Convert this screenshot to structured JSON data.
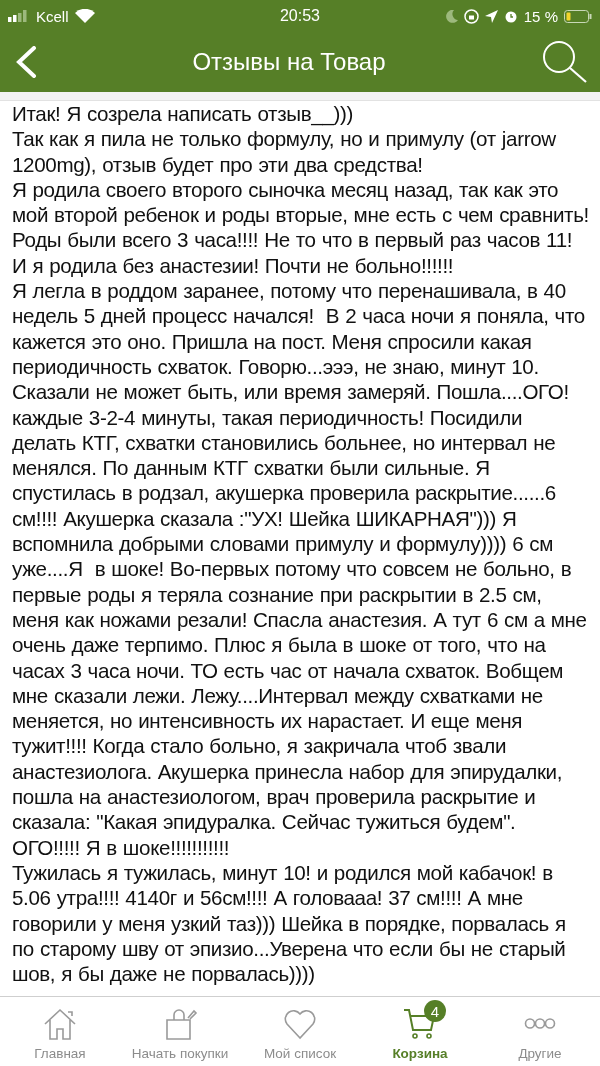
{
  "status_bar": {
    "carrier": "Kcell",
    "time": "20:53",
    "battery": "15 %"
  },
  "nav_bar": {
    "title": "Отзывы на Товар"
  },
  "review": {
    "paragraphs": [
      "Итак! Я созрела написать отзыв__)))",
      "Так как я пила не только формулу, но и примулу (от jarrow 1200mg), отзыв будет про эти два средства!",
      "Я родила своего второго сыночка месяц назад, так как это мой второй ребенок и роды вторые, мне есть с чем сравнить!",
      "Роды были всего 3 часа!!!! Не то что в первый раз часов 11! И я родила без анастезии! Почти не больно!!!!!!",
      "Я легла в роддом заранее, потому что перенашивала, в 40 недель 5 дней процесс начался!  В 2 часа ночи я поняла, что кажется это оно. Пришла на пост. Меня спросили какая периодичность схваток. Говорю...эээ, не знаю, минут 10. Сказали не может быть, или время замеряй. Пошла....ОГО! каждые 3-2-4 минуты, такая периодичность! Посидили делать КТГ, схватки становились больнее, но интервал не менялся. По данным КТГ схватки были сильные. Я спустилась в родзал, акушерка проверила раскрытие......6 см!!!! Акушерка сказала :\"УХ! Шейка ШИКАРНАЯ\"))) Я вспомнила добрыми словами примулу и формулу)))) 6 см уже....Я  в шоке! Во-первых потому что совсем не больно, в первые роды я теряла сознание при раскрытии в 2.5 см, меня как ножами резали! Спасла анастезия. А тут 6 см а мне очень даже терпимо. Плюс я была в шоке от того, что на часах 3 часа ночи. ТО есть час от начала схваток. Вобщем мне сказали лежи. Лежу....Интервал между схватками не меняется, но интенсивность их нарастает. И еще меня тужит!!!! Когда стало больно, я закричала чтоб звали анастезиолога. Акушерка принесла набор для эпирудалки, пошла на анастезиологом, врач проверила раскрытие и сказала: \"Какая эпидуралка. Сейчас тужиться будем\".   ОГО!!!!! Я в шоке!!!!!!!!!!!",
      "Тужилась я тужилась, минут 10! и родился мой кабачок! в 5.06 утра!!!! 4140г и 56см!!!! А головааа! 37 см!!!! А мне говорили у меня узкий таз))) Шейка в порядке, порвалась я по старому шву от эпизио...Уверена что если бы не старый шов, я бы даже не порвалась))))"
    ]
  },
  "tab_bar": {
    "items": [
      {
        "kind": "home",
        "label": "Главная",
        "selected": false
      },
      {
        "kind": "shop",
        "label": "Начать покупки",
        "selected": false
      },
      {
        "kind": "heart",
        "label": "Мой список",
        "selected": false
      },
      {
        "kind": "cart",
        "label": "Корзина",
        "selected": true,
        "badge": "4"
      },
      {
        "kind": "more",
        "label": "Другие",
        "selected": false
      }
    ]
  }
}
